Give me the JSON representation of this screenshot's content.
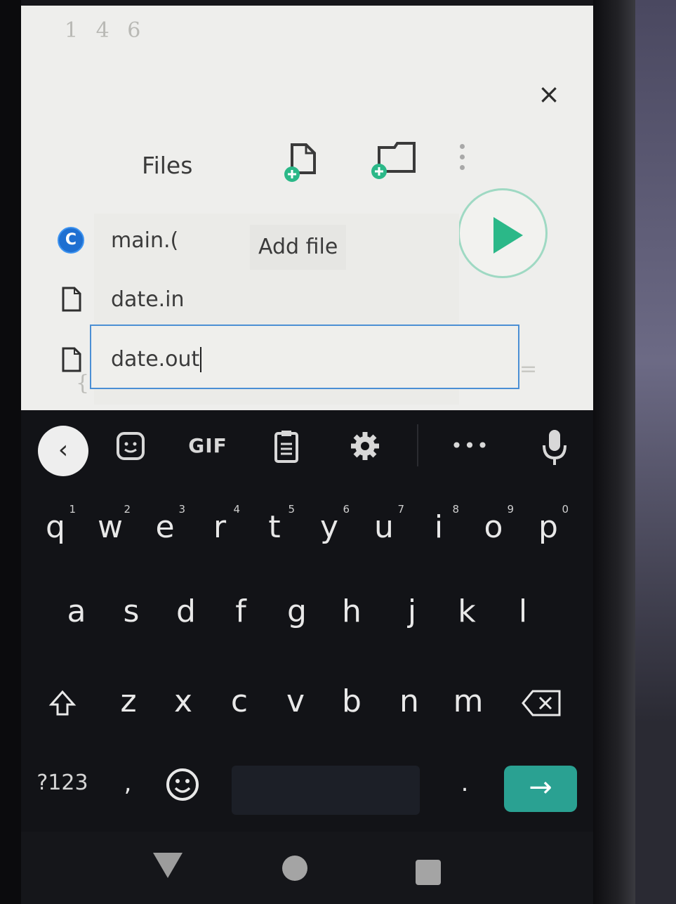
{
  "editor": {
    "line_numbers": "1 4 6",
    "left_brace": "{",
    "right_marker": "="
  },
  "dialog": {
    "title": "Files",
    "close_glyph": "×",
    "tooltip": "Add file",
    "files": [
      {
        "name": "main.c",
        "shown": "main.(",
        "icon": "c-language-icon"
      },
      {
        "name": "date.in",
        "icon": "file-icon"
      },
      {
        "name": "date.out",
        "icon": "file-icon",
        "editing": true
      }
    ]
  },
  "keyboard": {
    "toolbar": {
      "gif_label": "GIF",
      "more_label": "•••"
    },
    "row1": [
      {
        "key": "q",
        "hint": "1"
      },
      {
        "key": "w",
        "hint": "2"
      },
      {
        "key": "e",
        "hint": "3"
      },
      {
        "key": "r",
        "hint": "4"
      },
      {
        "key": "t",
        "hint": "5"
      },
      {
        "key": "y",
        "hint": "6"
      },
      {
        "key": "u",
        "hint": "7"
      },
      {
        "key": "i",
        "hint": "8"
      },
      {
        "key": "o",
        "hint": "9"
      },
      {
        "key": "p",
        "hint": "0"
      }
    ],
    "row2": [
      "a",
      "s",
      "d",
      "f",
      "g",
      "h",
      "j",
      "k",
      "l"
    ],
    "row3": [
      "z",
      "x",
      "c",
      "v",
      "b",
      "n",
      "m"
    ],
    "symbols_label": "?123",
    "comma": ",",
    "period": ".",
    "enter_glyph": "→"
  },
  "colors": {
    "accent": "#2bb888",
    "enter": "#2aa192",
    "focus_border": "#4b8fd4",
    "c_icon": "#1e6fd1"
  }
}
